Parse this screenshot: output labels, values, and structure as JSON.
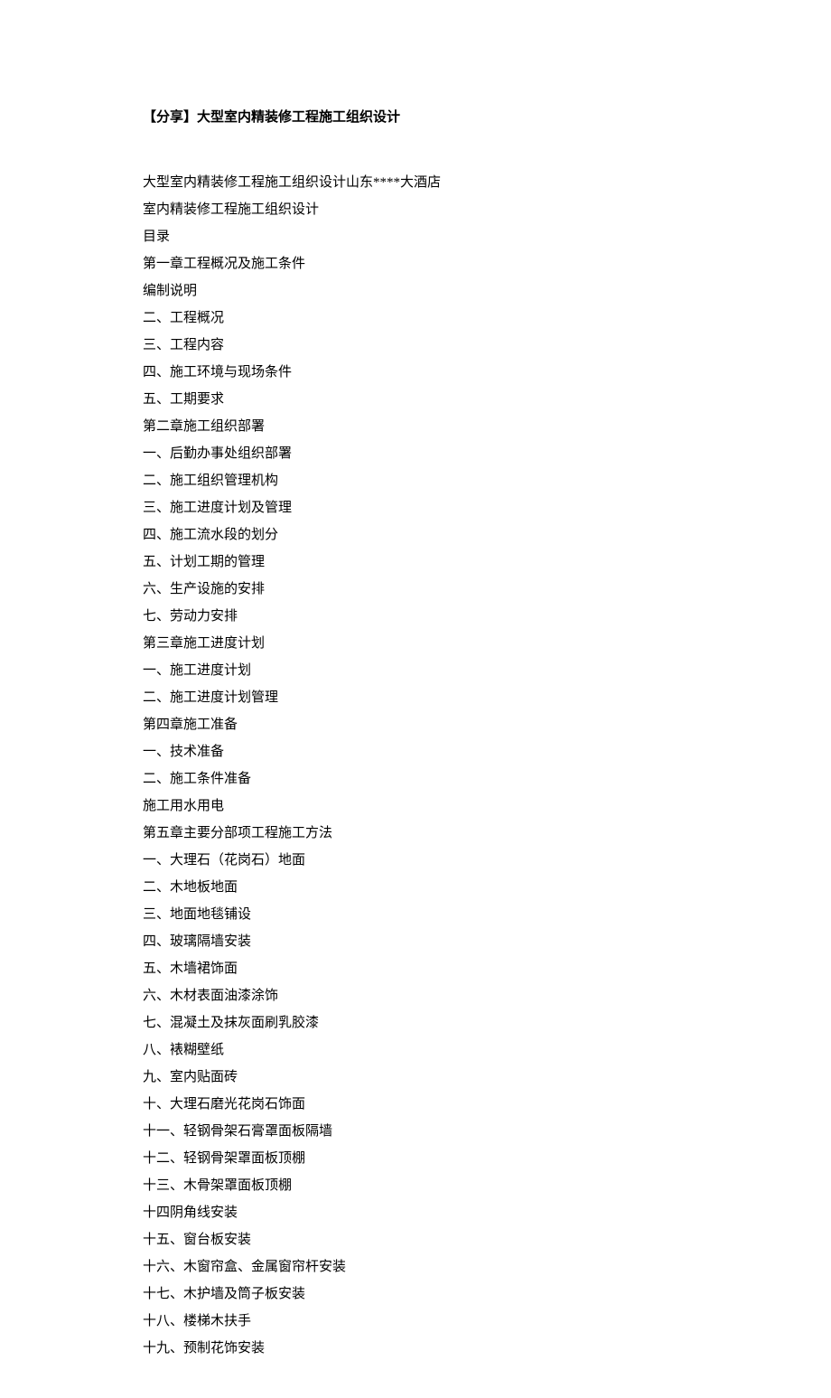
{
  "title": "【分享】大型室内精装修工程施工组织设计",
  "lines": [
    "大型室内精装修工程施工组织设计山东****大酒店",
    "室内精装修工程施工组织设计",
    "目录",
    "第一章工程概况及施工条件",
    "编制说明",
    "二、工程概况",
    "三、工程内容",
    "四、施工环境与现场条件",
    "五、工期要求",
    "第二章施工组织部署",
    "一、后勤办事处组织部署",
    "二、施工组织管理机构",
    "三、施工进度计划及管理",
    "四、施工流水段的划分",
    "五、计划工期的管理",
    "六、生产设施的安排",
    "七、劳动力安排",
    "第三章施工进度计划",
    "一、施工进度计划",
    "二、施工进度计划管理",
    "第四章施工准备",
    "一、技术准备",
    "二、施工条件准备",
    "施工用水用电",
    "第五章主要分部项工程施工方法",
    "一、大理石（花岗石）地面",
    "二、木地板地面",
    "三、地面地毯铺设",
    "四、玻璃隔墙安装",
    "五、木墙裙饰面",
    "六、木材表面油漆涂饰",
    "七、混凝土及抹灰面刷乳胶漆",
    "八、裱糊壁纸",
    "九、室内贴面砖",
    "十、大理石磨光花岗石饰面",
    "十一、轻钢骨架石膏罩面板隔墙",
    "十二、轻钢骨架罩面板顶棚",
    "十三、木骨架罩面板顶棚",
    "十四阴角线安装",
    "十五、窗台板安装",
    "十六、木窗帘盒、金属窗帘杆安装",
    "十七、木护墙及筒子板安装",
    "十八、楼梯木扶手",
    "十九、预制花饰安装"
  ]
}
